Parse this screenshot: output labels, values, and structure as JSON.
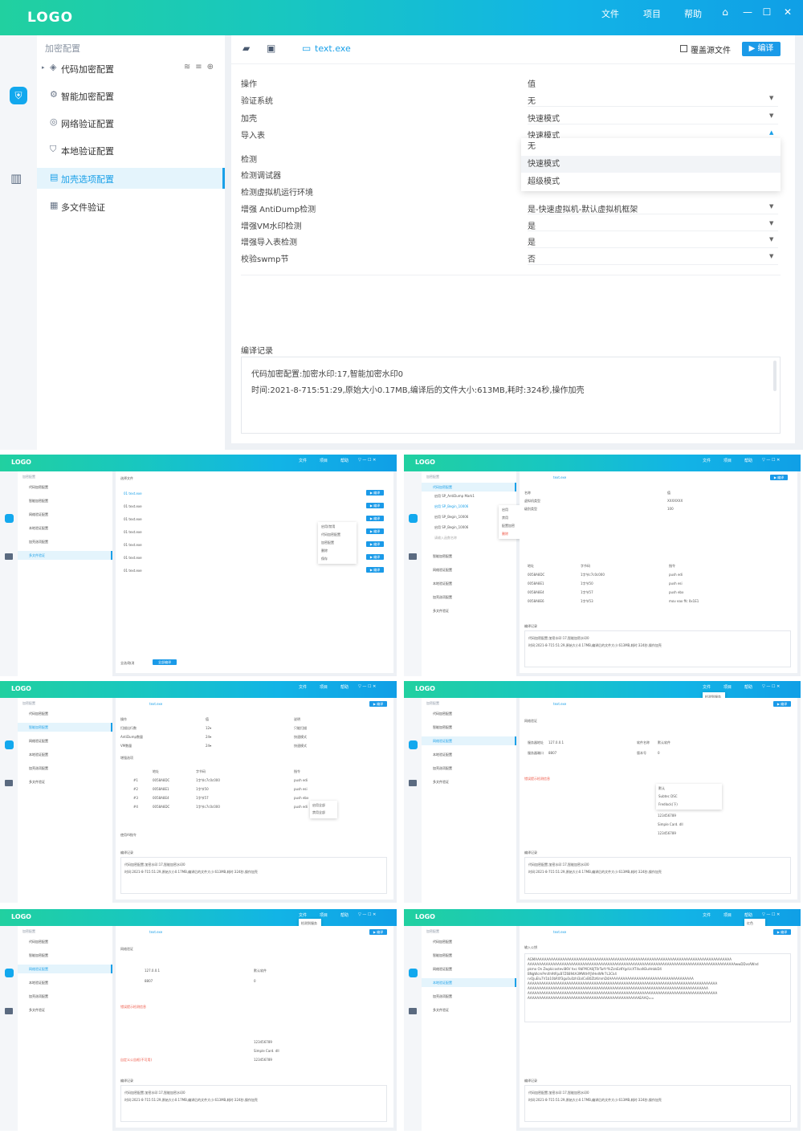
{
  "app": {
    "logo": "LOGO",
    "menu": [
      "文件",
      "项目",
      "帮助"
    ]
  },
  "sidebar": {
    "header": "加密配置",
    "items": [
      "代码加密配置",
      "智能加密配置",
      "网络验证配置",
      "本地验证配置",
      "加壳选项配置",
      "多文件验证"
    ],
    "active_index": 4
  },
  "toolbar": {
    "file_tab": "text.exe",
    "overwrite_label": "覆盖源文件",
    "compile_label": "编译"
  },
  "options": {
    "header_label": "操作",
    "header_value": "值",
    "rows": [
      {
        "label": "验证系统",
        "value": "无"
      },
      {
        "label": "加壳",
        "value": "快速模式"
      },
      {
        "label": "导入表",
        "value": "快速模式"
      },
      {
        "label": "检测",
        "value": ""
      },
      {
        "label": "检测调试器",
        "value": ""
      },
      {
        "label": "检测虚拟机运行环境",
        "value": ""
      },
      {
        "label": "增强 AntiDump检测",
        "value": "是-快速虚拟机-默认虚拟机框架"
      },
      {
        "label": "增强VM水印检测",
        "value": "是"
      },
      {
        "label": "增强导入表检测",
        "value": "是"
      },
      {
        "label": "校验swmp节",
        "value": "否"
      }
    ],
    "dropdown_options": [
      "无",
      "快速模式",
      "超级模式"
    ],
    "dropdown_selected": 1
  },
  "log": {
    "title": "编译记录",
    "lines": [
      "代码加密配置:加密水印:17,智能加密水印0",
      "时间:2021-8-715:51:29,原始大小0.17MB,编译后的文件大小:613MB,耗时:324秒,操作加壳"
    ]
  },
  "thumbs": {
    "t1": {
      "select_label": "选择文件",
      "files": [
        "01 text.exe",
        "01 text.exe",
        "01 text.exe",
        "01 text.exe",
        "01 text.exe",
        "01 text.exe",
        "01 text.exe"
      ],
      "menu": [
        "启用/禁用",
        "代码加密配置",
        "加密配置",
        "删除",
        "保存"
      ],
      "select_all": "全选/取消",
      "compile_all": "全部编译"
    },
    "t2": {
      "tree": [
        "启用 SP_AntiDump Mark1",
        "启用 SP_Begin_10006",
        "启用 SP_Begin_10006",
        "启用 SP_Begin_10006"
      ],
      "search_placeholder": "请输入函数名称",
      "ctx": [
        "启用",
        "禁用",
        "配置加密",
        "删除"
      ],
      "rows": [
        {
          "k": "名称",
          "v": "值"
        },
        {
          "k": "虚拟机类型",
          "v": "XXXXXXX"
        },
        {
          "k": "级别类型",
          "v": "100"
        }
      ],
      "fn_rows": [
        {
          "k": "地址",
          "a": "字节码",
          "b": "指令"
        },
        {
          "k": "0058A8DC",
          "a": "1字节c7c0c000",
          "b": "push edi"
        },
        {
          "k": "0058A8E1",
          "a": "1字节50",
          "b": "push esi"
        },
        {
          "k": "0058A8E4",
          "a": "1字节57",
          "b": "push ebx"
        },
        {
          "k": "0058A8E6",
          "a": "1字节53",
          "b": "mov eax ffc 0x1E1"
        }
      ]
    },
    "t3": {
      "cols": [
        "操作",
        "值",
        "说明"
      ],
      "rows": [
        {
          "a": "扫描出行数",
          "b": "12▾",
          "c": "只能扫描"
        },
        {
          "a": "AntiDump数量",
          "b": "24▾",
          "c": "快速模式"
        },
        {
          "a": "VM数量",
          "b": "24▾",
          "c": "快速模式"
        }
      ],
      "section": "增强选项",
      "table_head": [
        "地址",
        "字节码",
        "指令"
      ],
      "table": [
        {
          "n": "#1",
          "a": "0058A8DC",
          "b": "1字节c7c0c000",
          "c": "push edi"
        },
        {
          "n": "#2",
          "a": "0058A8E1",
          "b": "1字节50",
          "c": "push esi"
        },
        {
          "n": "#3",
          "a": "0058A8E4",
          "b": "1字节57",
          "c": "push ebx"
        },
        {
          "n": "#4",
          "a": "0058A8DC",
          "b": "1字节c7c0c000",
          "c": "push edi"
        }
      ],
      "ctx": [
        "启用全部",
        "禁用全部"
      ],
      "footer_chk": "使用AI指令"
    },
    "t4": {
      "section": "网络验证",
      "server_label": "服务器地址",
      "server_value": "127.0.0.1",
      "port_label": "服务器端口",
      "port_value": "8807",
      "soft_label": "软件名称",
      "soft_value": "默认软件",
      "ver_label": "版本号",
      "ver_value": "0",
      "warn": "错误提示检测信息",
      "menu": [
        "检测到服务",
        "检测时间",
        "检测间隔"
      ],
      "dd": [
        "默认",
        "Subtec DSC",
        "Fredlock(下)"
      ],
      "values": [
        "123456789",
        "Simple Card. dll",
        "123456789"
      ]
    },
    "t5": {
      "section": "网络验证",
      "server_value": "127.0.0.1",
      "port_value": "8807",
      "soft_value": "默认软件",
      "ver_value": "0",
      "warn": "错误提示检测信息",
      "custom": "自定义公告框(不可用)",
      "values": [
        "123456789",
        "Simple Card. dll",
        "123456789"
      ],
      "menu": [
        "检测到服务",
        "检测时间",
        "检测间隔"
      ]
    },
    "t6": {
      "section": "输入公钥",
      "key_lines": [
        "AGMAAAAAAAAAAAAAAAAAAAAAAAAAAAAAAAAAAAAAAAAAAAAAAAAAAAAAAAAAAAAAAAAAAAAAAAAAAAAAAAAAAAAAA",
        "AAAAAAAAAAAAAAAAAAAAAAAAAAAAAAAAAAAAAAAAAAAAAAAAAAAAAAAAAAAAAAAAAAAAAAAAAAAAAAAAAAAAAAAAAAAwwDDvsAWnd",
        "pkmo On Zwpkicostevi86V hxc 9bFMCA8jT0rTwYrYkZznEzKYgcUcXT4vaN3uHnbkD4",
        "BNgWcmPmXh9tRjuB7Z6894A3MWtHYJVHeW9r7L3Ck4",
        "rvQjuEIu7V1b10bR0f3gu0u0zhI3alCvB0ZIzKmmD4AAAAAAAAAAAAAAAAAAAAAAAAAAAAAAAAAAAAA",
        "AAAAAAAAAAAAAAAAAAAAAAAAAAAAAAAAAAAAAAAAAAAAAAAAAAAAAAAAAAAAAAAAAAAAAAAAAAAAAAAAAAA",
        "AAAAAAAAAAAAAAAAAAAAAAAAAAAAAAAAAAAAAAAAAAAAAAAAAAAAAAAAAAAAAAAAAAAAAAAAAAAAAAA",
        "AAAAAAAAAAAAAAAAAAAAAAAAAAAAAAAAAAAAAAAAAAAAAAAAAAAAAAAAAAAAAAAAAAAAAAAAAAAAAAAAAAA",
        "AAAAAAAAAAAAAAAAAAAAAAAAAAAAAAAAAAAAAAAAAAAAAAAAAEAAQ=="
      ],
      "menu": [
        "红色",
        "蓝色",
        "黑色"
      ]
    }
  }
}
